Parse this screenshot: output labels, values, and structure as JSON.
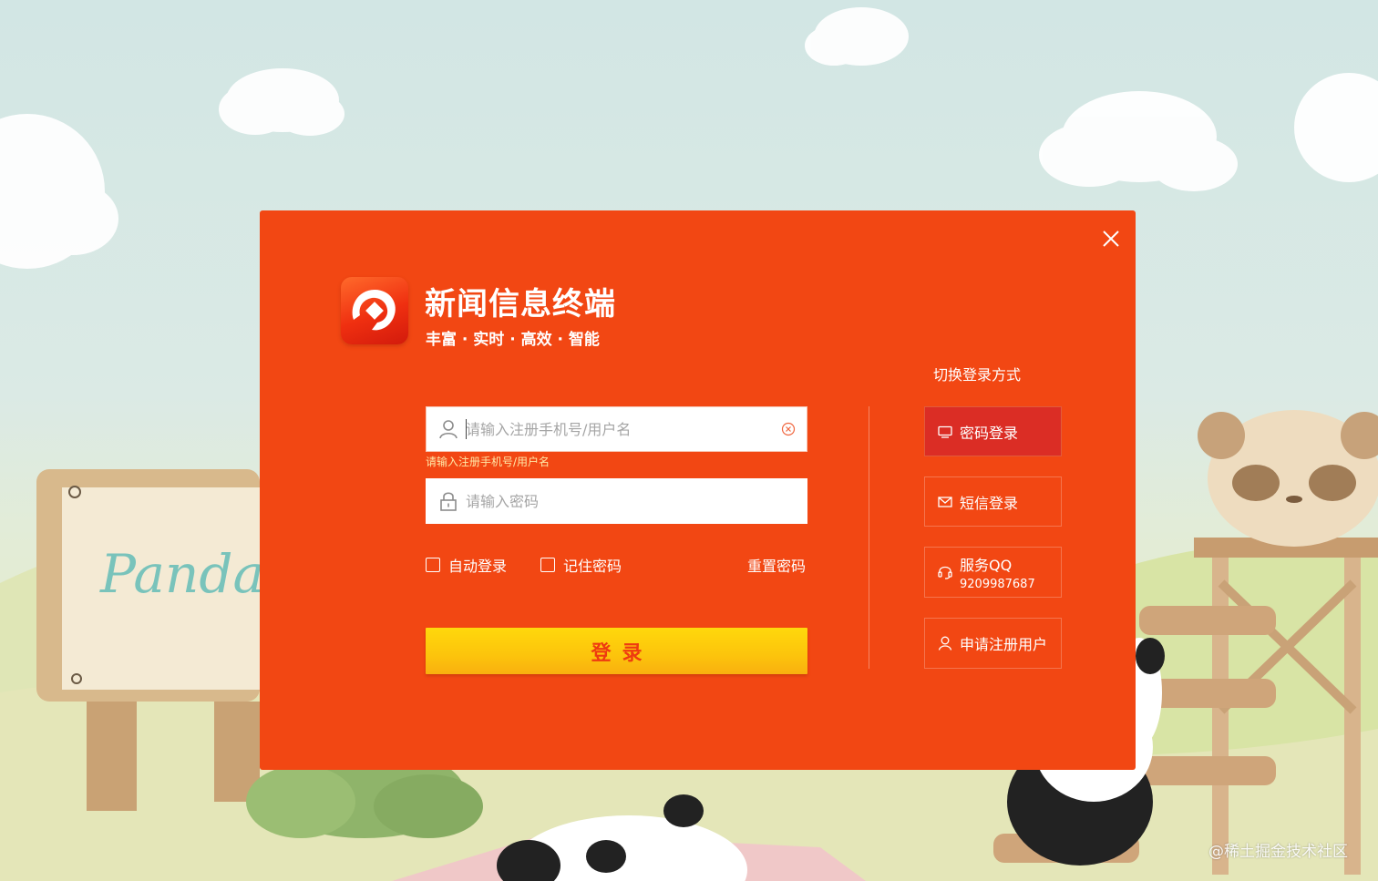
{
  "app": {
    "title": "新闻信息终端",
    "slogan": "丰富 · 实时 · 高效 · 智能"
  },
  "form": {
    "username_placeholder": "请输入注册手机号/用户名",
    "username_error": "请输入注册手机号/用户名",
    "password_placeholder": "请输入密码",
    "auto_login_label": "自动登录",
    "remember_label": "记住密码",
    "reset_label": "重置密码",
    "login_label": "登录"
  },
  "switcher": {
    "title": "切换登录方式",
    "password_login": "密码登录",
    "sms_login": "短信登录",
    "qq_label": "服务QQ",
    "qq_number": "9209987687",
    "register": "申请注册用户"
  },
  "background": {
    "sign_text": "Panda Rob"
  },
  "watermark": "@稀土掘金技术社区",
  "colors": {
    "dialog": "#f24713",
    "active_tab": "#db2d25",
    "login_button": "#fcc40c",
    "login_text": "#ee3b10"
  }
}
